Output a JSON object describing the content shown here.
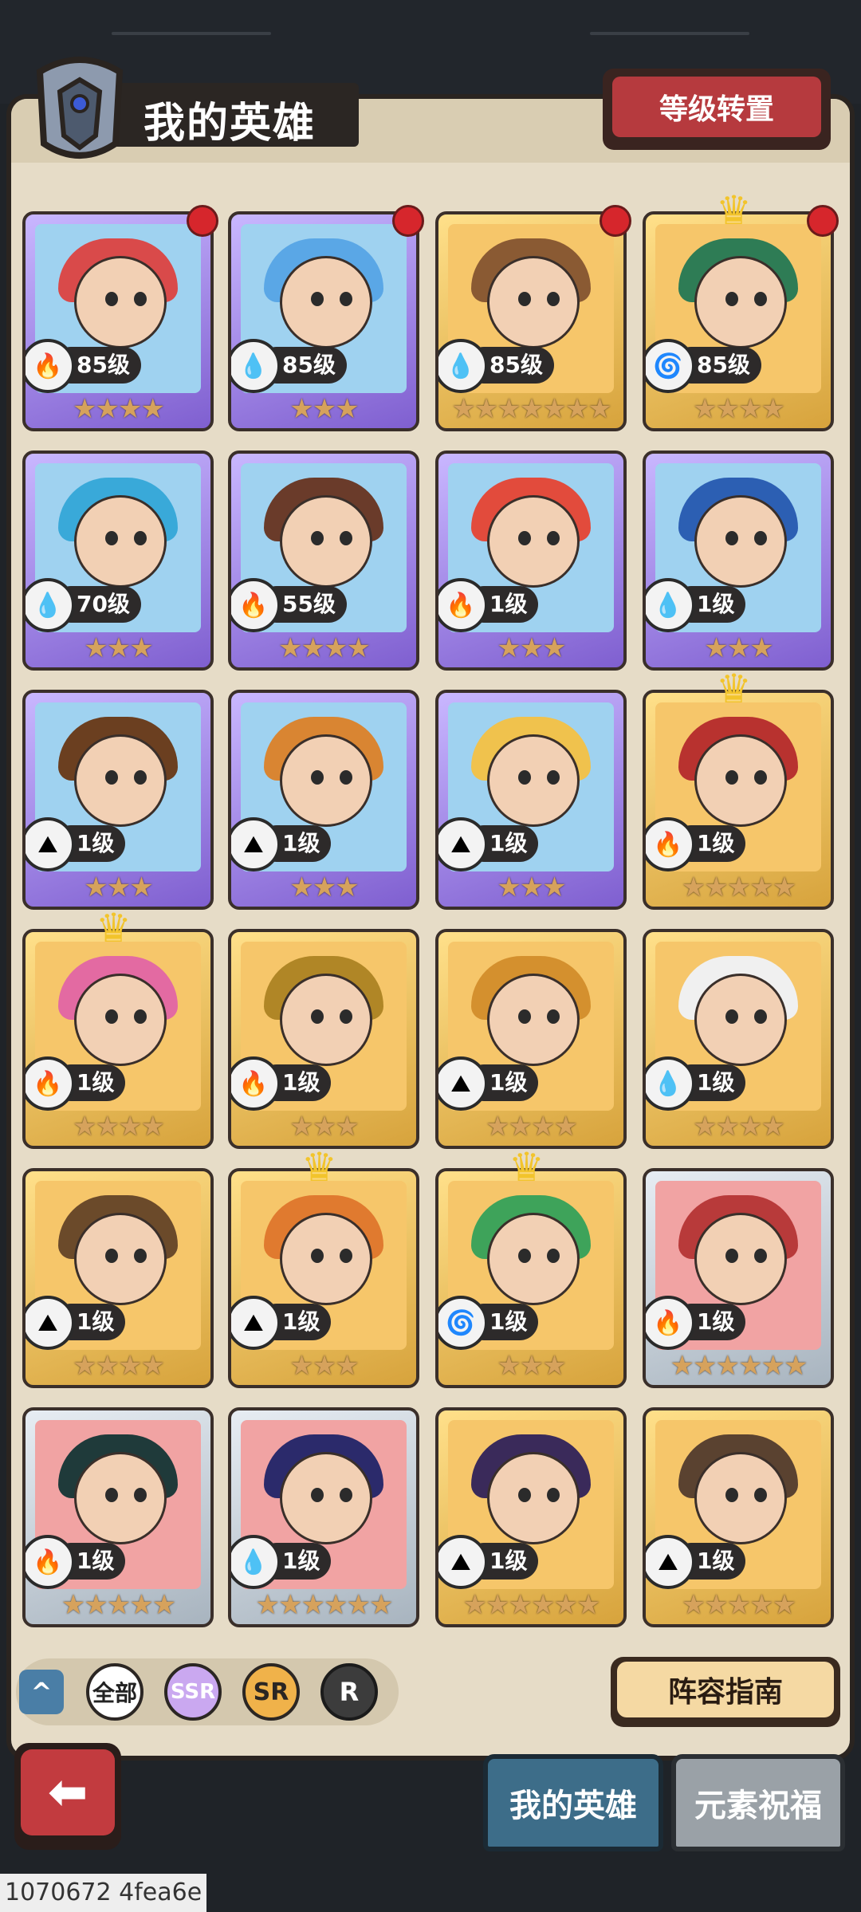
{
  "header": {
    "title": "我的英雄",
    "level_transfer_label": "等级转置"
  },
  "heroes": [
    {
      "level": "85级",
      "stars": "★★★★",
      "rarity": "ssr",
      "element": "fire",
      "red_dot": true,
      "crown": false,
      "hair": "#d94a4a"
    },
    {
      "level": "85级",
      "stars": "★★★",
      "rarity": "ssr",
      "element": "water",
      "red_dot": true,
      "crown": false,
      "hair": "#5aa7e6"
    },
    {
      "level": "85级",
      "stars": "★★★★★★★",
      "rarity": "sr",
      "element": "water",
      "red_dot": true,
      "crown": false,
      "hair": "#8a5a33"
    },
    {
      "level": "85级",
      "stars": "★★★★",
      "rarity": "sr",
      "element": "wind",
      "red_dot": true,
      "crown": true,
      "hair": "#2e7c55"
    },
    {
      "level": "70级",
      "stars": "★★★",
      "rarity": "ssr",
      "element": "water",
      "red_dot": false,
      "crown": false,
      "hair": "#39a9d9"
    },
    {
      "level": "55级",
      "stars": "★★★★",
      "rarity": "ssr",
      "element": "fire",
      "red_dot": false,
      "crown": false,
      "hair": "#6a3b2a"
    },
    {
      "level": "1级",
      "stars": "★★★",
      "rarity": "ssr",
      "element": "fire",
      "red_dot": false,
      "crown": false,
      "hair": "#e24b3c"
    },
    {
      "level": "1级",
      "stars": "★★★",
      "rarity": "ssr",
      "element": "water",
      "red_dot": false,
      "crown": false,
      "hair": "#2c5fb3"
    },
    {
      "level": "1级",
      "stars": "★★★",
      "rarity": "ssr",
      "element": "earth",
      "red_dot": false,
      "crown": false,
      "hair": "#6b3f20"
    },
    {
      "level": "1级",
      "stars": "★★★",
      "rarity": "ssr",
      "element": "earth",
      "red_dot": false,
      "crown": false,
      "hair": "#d98532"
    },
    {
      "level": "1级",
      "stars": "★★★",
      "rarity": "ssr",
      "element": "earth",
      "red_dot": false,
      "crown": false,
      "hair": "#f0c24d"
    },
    {
      "level": "1级",
      "stars": "★★★★★",
      "rarity": "sr",
      "element": "fire",
      "red_dot": false,
      "crown": true,
      "hair": "#b8322f"
    },
    {
      "level": "1级",
      "stars": "★★★★",
      "rarity": "sr",
      "element": "fire",
      "red_dot": false,
      "crown": true,
      "hair": "#e36aa2"
    },
    {
      "level": "1级",
      "stars": "★★★",
      "rarity": "sr",
      "element": "fire",
      "red_dot": false,
      "crown": false,
      "hair": "#b08626"
    },
    {
      "level": "1级",
      "stars": "★★★★",
      "rarity": "sr",
      "element": "earth",
      "red_dot": false,
      "crown": false,
      "hair": "#d4902e"
    },
    {
      "level": "1级",
      "stars": "★★★★",
      "rarity": "sr",
      "element": "water",
      "red_dot": false,
      "crown": false,
      "hair": "#f0f0f0"
    },
    {
      "level": "1级",
      "stars": "★★★★",
      "rarity": "sr",
      "element": "earth",
      "red_dot": false,
      "crown": false,
      "hair": "#6b4a2a"
    },
    {
      "level": "1级",
      "stars": "★★★",
      "rarity": "sr",
      "element": "earth",
      "red_dot": false,
      "crown": true,
      "hair": "#e07a2f"
    },
    {
      "level": "1级",
      "stars": "★★★",
      "rarity": "sr",
      "element": "wind",
      "red_dot": false,
      "crown": true,
      "hair": "#3ea35a"
    },
    {
      "level": "1级",
      "stars": "★★★★★★",
      "rarity": "r",
      "element": "fire",
      "red_dot": false,
      "crown": false,
      "hair": "#b83a3a"
    },
    {
      "level": "1级",
      "stars": "★★★★★",
      "rarity": "r",
      "element": "fire",
      "red_dot": false,
      "crown": false,
      "hair": "#1f3a3a"
    },
    {
      "level": "1级",
      "stars": "★★★★★★",
      "rarity": "r",
      "element": "water",
      "red_dot": false,
      "crown": false,
      "hair": "#2b2a6b"
    },
    {
      "level": "1级",
      "stars": "★★★★★★",
      "rarity": "sr",
      "element": "earth",
      "red_dot": false,
      "crown": false,
      "hair": "#3a2a5a"
    },
    {
      "level": "1级",
      "stars": "★★★★★",
      "rarity": "sr",
      "element": "earth",
      "red_dot": false,
      "crown": false,
      "hair": "#5a4230"
    }
  ],
  "element_glyphs": {
    "fire": "🔥",
    "water": "💧",
    "wind": "🌀",
    "earth": "⛰"
  },
  "filters": {
    "collapse_icon": "^",
    "all_label": "全部",
    "ssr_label": "SSR",
    "sr_label": "SR",
    "r_label": "R"
  },
  "guide_label": "阵容指南",
  "tabs": {
    "my_heroes": "我的英雄",
    "element_blessing": "元素祝福"
  },
  "footer_text": "1070672 4fea6e"
}
